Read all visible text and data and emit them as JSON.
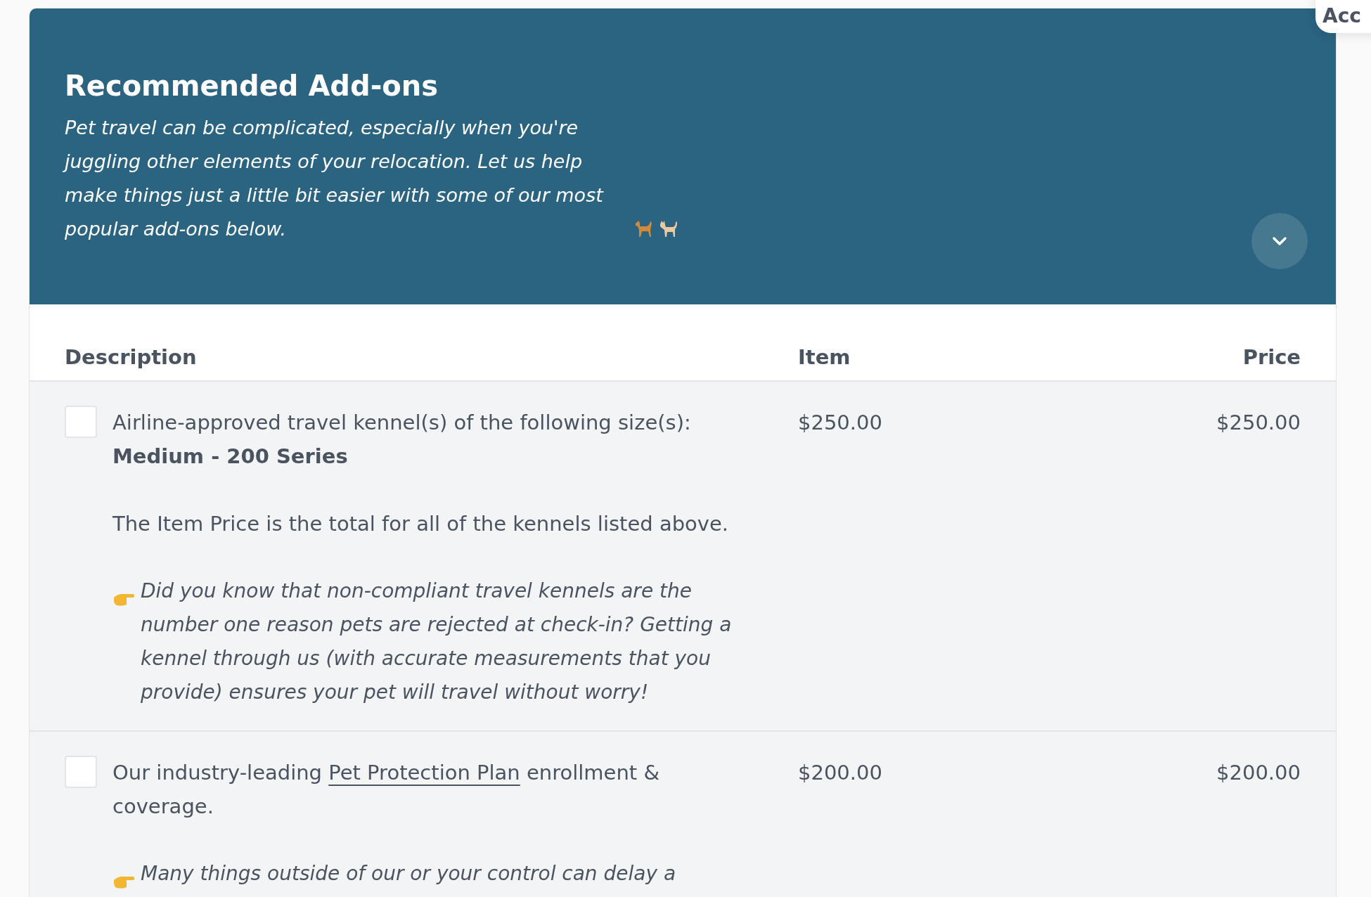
{
  "corner_button": {
    "label": "Acc"
  },
  "header": {
    "title": "Recommended Add-ons",
    "intro": "Pet travel can be complicated, especially when you're juggling other elements of your relocation. Let us help make things just a little bit easier with some of our most popular add-ons below."
  },
  "table": {
    "columns": [
      "Description",
      "Item",
      "Price"
    ],
    "rows": [
      {
        "checked": false,
        "description": [
          {
            "kind": "text",
            "text": "Airline-approved travel kennel(s) of the following size(s):"
          },
          {
            "kind": "strong",
            "text": "Medium - 200 Series"
          }
        ],
        "notes": [
          {
            "kind": "plain",
            "text": "The Item Price is the total for all of the kennels listed above."
          },
          {
            "kind": "tip",
            "text": "Did you know that non-compliant travel kennels are the number one reason pets are rejected at check-in? Getting a kennel through us (with accurate measurements that you provide) ensures your pet will travel without worry!"
          }
        ],
        "item": "$250.00",
        "price": "$250.00"
      },
      {
        "checked": false,
        "description": [
          {
            "kind": "text",
            "text": "Our industry-leading"
          },
          {
            "kind": "link",
            "text": "Pet Protection Plan"
          },
          {
            "kind": "text",
            "text": "enrollment & coverage."
          }
        ],
        "notes": [
          {
            "kind": "tip",
            "text": "Many things outside of our or your control can delay a"
          }
        ],
        "item": "$200.00",
        "price": "$200.00"
      }
    ]
  }
}
